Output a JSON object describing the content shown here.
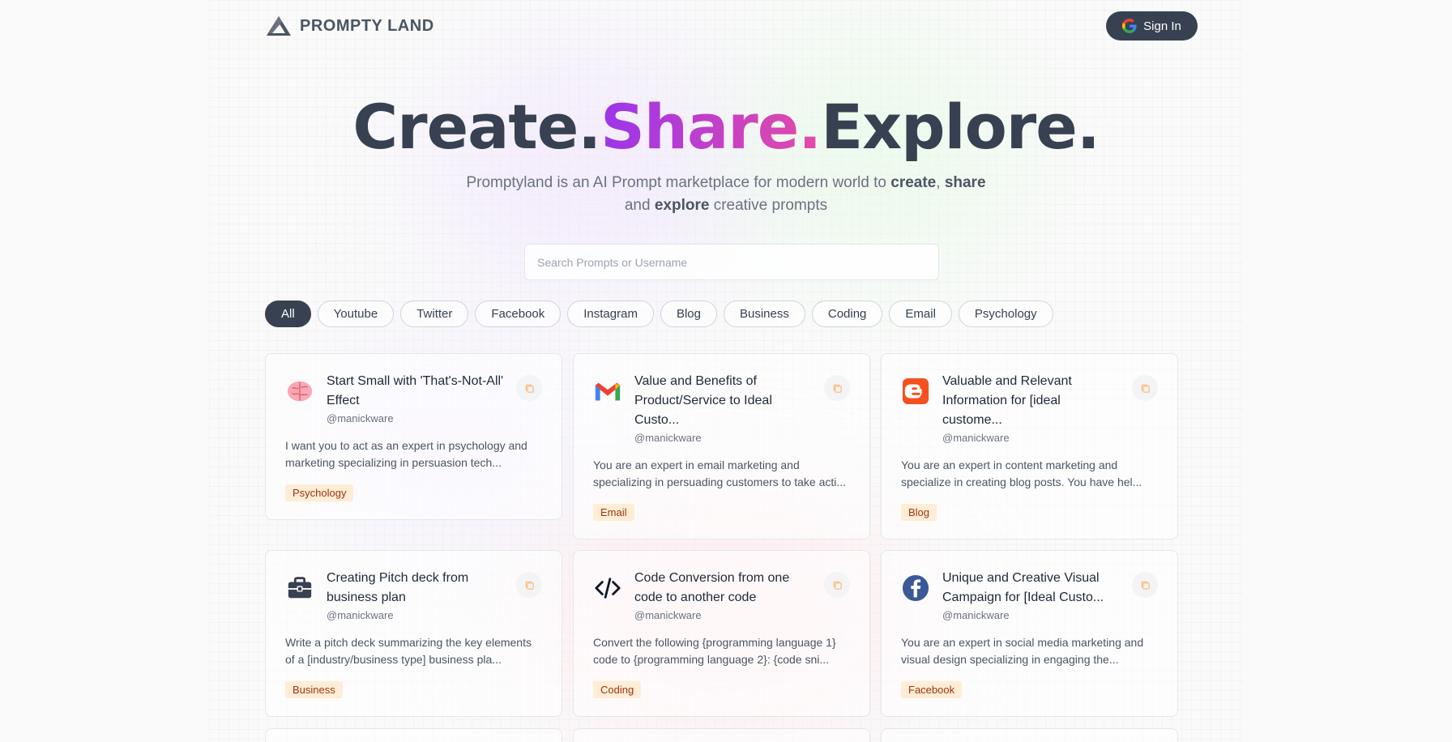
{
  "brand": {
    "name": "PROMPTY LAND"
  },
  "nav": {
    "signin_label": "Sign In"
  },
  "hero": {
    "title_part1": "Create.",
    "title_part2": "Share.",
    "title_part3": "Explore.",
    "subtitle_a": "Promptyland is an AI Prompt marketplace for modern world to ",
    "subtitle_b": "create",
    "subtitle_c": ", ",
    "subtitle_d": "share",
    "subtitle_e": "and ",
    "subtitle_f": "explore",
    "subtitle_g": " creative prompts"
  },
  "search": {
    "placeholder": "Search Prompts or Username"
  },
  "categories": [
    "All",
    "Youtube",
    "Twitter",
    "Facebook",
    "Instagram",
    "Blog",
    "Business",
    "Coding",
    "Email",
    "Psychology"
  ],
  "prompts": [
    {
      "title": "Start Small with 'That's-Not-All' Effect",
      "user": "@manickware",
      "body": "I want you to act as an expert in psychology and marketing specializing in persuasion tech...",
      "tag": "Psychology",
      "icon": "brain-icon"
    },
    {
      "title": "Value and Benefits of Product/Service to Ideal Custo...",
      "user": "@manickware",
      "body": "You are an expert in email marketing and specializing in persuading customers to take acti...",
      "tag": "Email",
      "icon": "gmail-icon"
    },
    {
      "title": "Valuable and Relevant Information for [ideal custome...",
      "user": "@manickware",
      "body": "You are an expert in content marketing and specialize in creating blog posts. You have hel...",
      "tag": "Blog",
      "icon": "blogger-icon"
    },
    {
      "title": "Creating Pitch deck from business plan",
      "user": "@manickware",
      "body": "Write a pitch deck summarizing the key elements of a [industry/business type] business pla...",
      "tag": "Business",
      "icon": "briefcase-icon"
    },
    {
      "title": "Code Conversion from one code to another code",
      "user": "@manickware",
      "body": "Convert the following {programming language 1} code to {programming language 2}: {code sni...",
      "tag": "Coding",
      "icon": "code-icon"
    },
    {
      "title": "Unique and Creative Visual Campaign for [Ideal Custo...",
      "user": "@manickware",
      "body": "You are an expert in social media marketing and visual design specializing in engaging the...",
      "tag": "Facebook",
      "icon": "facebook-icon"
    }
  ],
  "colors": {
    "primary": "#374151",
    "accent_purple": "#9b35ea",
    "accent_pink": "#e64aa8",
    "tag_bg": "#ffedd5",
    "tag_text": "#9a3412"
  }
}
